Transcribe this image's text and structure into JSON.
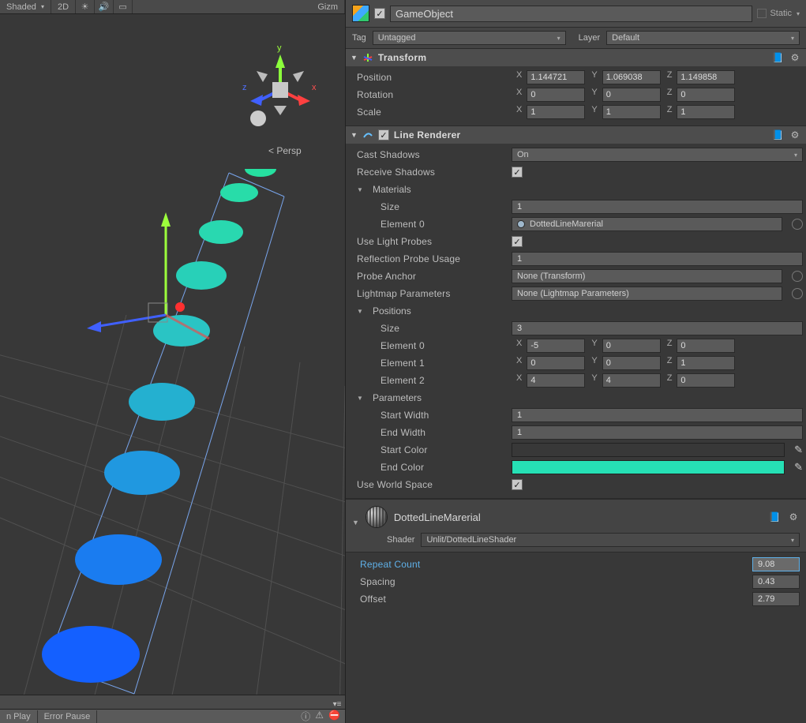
{
  "scene_toolbar": {
    "shading": "Shaded",
    "btn_2d": "2D",
    "gizmo": "Gizm"
  },
  "scene_overlay": {
    "persp": "Persp",
    "x": "x",
    "y": "y",
    "z": "z"
  },
  "bottom_tabs": {
    "play": "n Play",
    "error_pause": "Error Pause"
  },
  "inspector": {
    "name": "GameObject",
    "static_label": "Static",
    "tag_label": "Tag",
    "tag_value": "Untagged",
    "layer_label": "Layer",
    "layer_value": "Default"
  },
  "transform": {
    "title": "Transform",
    "position_label": "Position",
    "rotation_label": "Rotation",
    "scale_label": "Scale",
    "pos": {
      "x": "1.144721",
      "y": "1.069038",
      "z": "1.149858"
    },
    "rot": {
      "x": "0",
      "y": "0",
      "z": "0"
    },
    "scale": {
      "x": "1",
      "y": "1",
      "z": "1"
    }
  },
  "line_renderer": {
    "title": "Line Renderer",
    "cast_shadows_label": "Cast Shadows",
    "cast_shadows_value": "On",
    "receive_shadows_label": "Receive Shadows",
    "materials_label": "Materials",
    "materials_size_label": "Size",
    "materials_size_value": "1",
    "element0_label": "Element 0",
    "element0_value": "DottedLineMarerial",
    "use_light_probes_label": "Use Light Probes",
    "reflection_probe_label": "Reflection Probe Usage",
    "reflection_probe_value": "1",
    "probe_anchor_label": "Probe Anchor",
    "probe_anchor_value": "None (Transform)",
    "lightmap_params_label": "Lightmap Parameters",
    "lightmap_params_value": "None (Lightmap Parameters)",
    "positions_label": "Positions",
    "positions_size_label": "Size",
    "positions_size_value": "3",
    "pos0_label": "Element 0",
    "pos0": {
      "x": "-5",
      "y": "0",
      "z": "0"
    },
    "pos1_label": "Element 1",
    "pos1": {
      "x": "0",
      "y": "0",
      "z": "1"
    },
    "pos2_label": "Element 2",
    "pos2": {
      "x": "4",
      "y": "4",
      "z": "0"
    },
    "parameters_label": "Parameters",
    "start_width_label": "Start Width",
    "start_width_value": "1",
    "end_width_label": "End Width",
    "end_width_value": "1",
    "start_color_label": "Start Color",
    "start_color_value": "#1430ff",
    "end_color_label": "End Color",
    "end_color_value": "#26e0b5",
    "use_world_space_label": "Use World Space"
  },
  "material": {
    "name": "DottedLineMarerial",
    "shader_label": "Shader",
    "shader_value": "Unlit/DottedLineShader",
    "repeat_count_label": "Repeat Count",
    "repeat_count_value": "9.08",
    "spacing_label": "Spacing",
    "spacing_value": "0.43",
    "offset_label": "Offset",
    "offset_value": "2.79"
  }
}
